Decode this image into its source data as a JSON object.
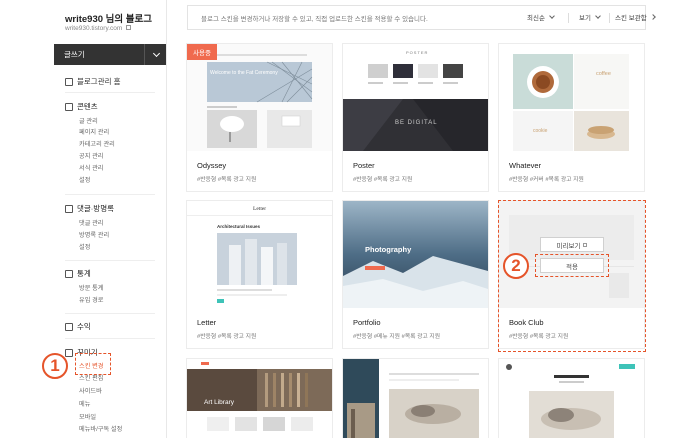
{
  "sidebar": {
    "blog_title": "write930 님의 블로그",
    "blog_url": "write930.tistory.com",
    "write_button": "글쓰기",
    "home_link": "블로그관리 홈",
    "content": {
      "title": "콘텐츠",
      "items": [
        "글 관리",
        "페이지 관리",
        "카테고리 관리",
        "공지 관리",
        "서식 관리",
        "설정"
      ]
    },
    "comments": {
      "title": "댓글·방명록",
      "items": [
        "댓글 관리",
        "방명록 관리",
        "설정"
      ]
    },
    "stats": {
      "title": "통계",
      "items": [
        "방문 통계",
        "유입 경로"
      ]
    },
    "revenue": {
      "title": "수익"
    },
    "customize": {
      "title": "꾸미기",
      "items": [
        "스킨 변경",
        "스킨 편집",
        "사이드바",
        "메뉴",
        "모바일",
        "메뉴바/구독 설정"
      ]
    }
  },
  "topbar": {
    "description": "블로그 스킨을 변경하거나 저장할 수 있고, 직접 업로드한 스킨을 적용할 수 있습니다.",
    "sort_label": "최신순",
    "view_label": "보기",
    "storage_label": "스킨 보관함"
  },
  "skins": [
    {
      "name": "Odyssey",
      "tags": "#반응형  #목록 광고 지원",
      "badge": "사용중"
    },
    {
      "name": "Poster",
      "tags": "#반응형  #목록 광고 지원"
    },
    {
      "name": "Whatever",
      "tags": "#반응형  #커버  #목록 광고 지원"
    },
    {
      "name": "Letter",
      "tags": "#반응형  #목록 광고 지원"
    },
    {
      "name": "Portfolio",
      "tags": "#반응형  #메뉴 지원  #목록 광고 지원"
    },
    {
      "name": "Book Club",
      "tags": "#반응형  #목록 광고 지원"
    }
  ],
  "thumb_text": {
    "odyssey_hero": "Welcome to the Fat Ceremony",
    "poster_logo": "POSTER",
    "poster_banner": "BE DIGITAL",
    "whatever_coffee": "coffee",
    "whatever_cookie": "cookie",
    "letter_logo": "Letter",
    "letter_heading": "Architectural Issues",
    "portfolio_heading": "Photography",
    "art_library": "Art Library"
  },
  "hover": {
    "preview_button": "미리보기",
    "apply_button": "적용"
  },
  "annotations": {
    "step1": "1",
    "step2": "2"
  }
}
